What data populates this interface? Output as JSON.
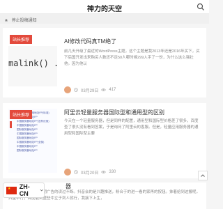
{
  "header": {
    "title": "神力的天空"
  },
  "notice": {
    "text": "停止投稿通知"
  },
  "posts": [
    {
      "badge": "站长推荐",
      "thumb_code": "malink() . '",
      "title": "AI修改代码真TM绝了",
      "excerpt": "前几天升级了最近的WordPress主题，这个主题是我2013年还是2016年买下，买下后国开发出来购买人数还不足50人哪时候299入手了一份，为什么这么强壮他。因为他认",
      "date": "03月29日",
      "views": "417"
    },
    {
      "badge": "站长推荐",
      "thumb_text": "国际服务器通用地址FP(标准)\n国际服务器地址FP\n中国服务器地址FP(没有优惠)\n中国服务器地址FP\n国际服务器地址FP\n中国服务器地址FP\n国际服务器地址FP\n中国服务器地址FP(全部)\n中国服务器地址FP\n国际服务器地址FP",
      "title": "阿里云轻量服务器国际型和通用型的区别",
      "excerpt": "今天在一个轻量服务器，但是同样的配置，通用型和国际型价格差了很多，百度查了很久没有看到答案，于是询问了阿里云的客服。但是，轻量应用服务器的通用型和国际型主要",
      "date": "03月20日",
      "views": "330"
    },
    {
      "title": "器",
      "excerpt": "有那么一种冲动；周期广告的读过不断。抖音会的是兴趣推送，粉合于的进一看的家再的按钮。抹着给到这搬呢，抖量中行，百度能到整些中立于到人就行，我接下上生，"
    }
  ],
  "lang": {
    "label": "ZH-CN"
  },
  "colors": {
    "accent": "#e34a3c",
    "link": "#4a5aa8"
  },
  "icons": [
    "search-icon",
    "bell-icon",
    "clock-icon",
    "eye-icon",
    "chevron-up-icon",
    "chevron-down-icon",
    "flag-icon"
  ]
}
